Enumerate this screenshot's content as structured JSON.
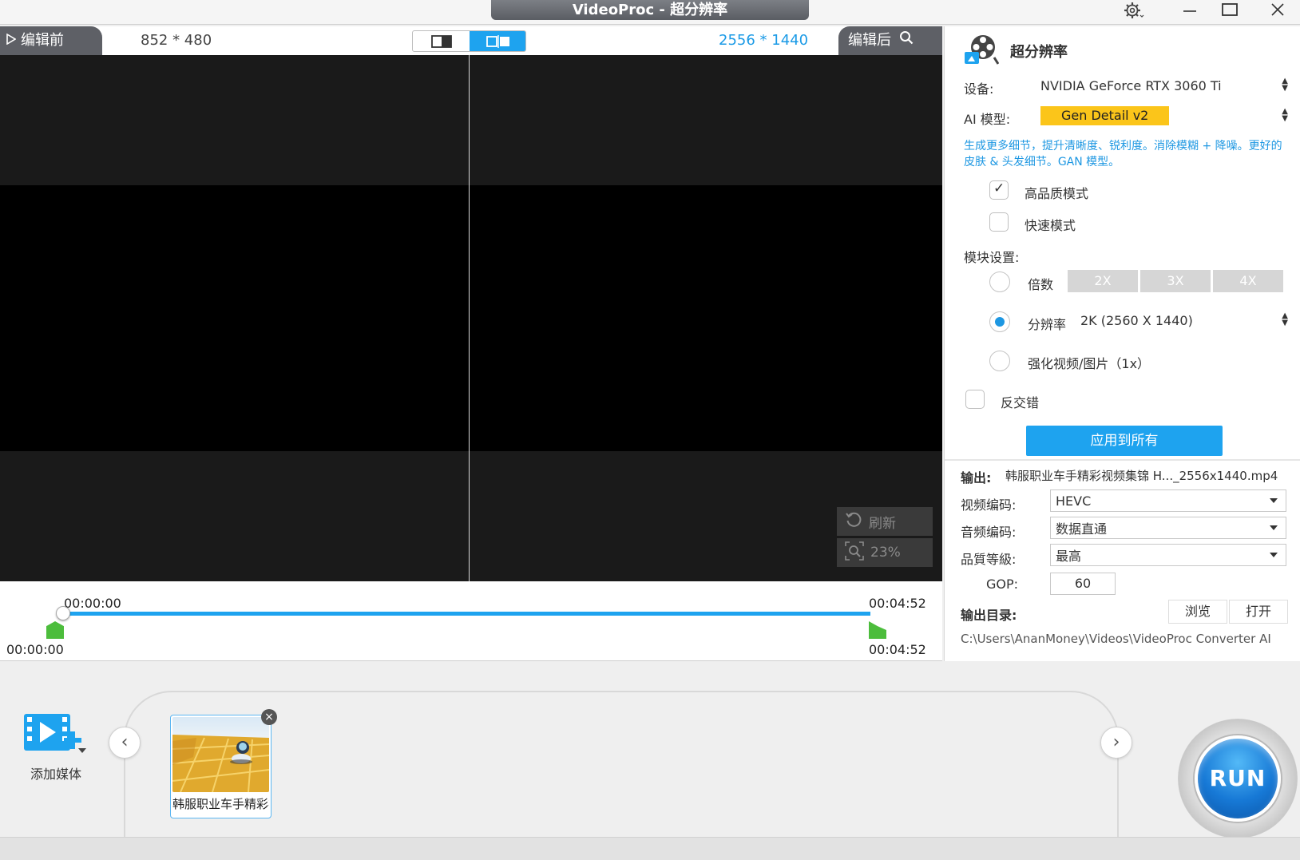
{
  "window": {
    "title": "VideoProc -  超分辨率",
    "settings_icon": "gear-icon",
    "minimize_icon": "minimize-icon",
    "maximize_icon": "maximize-icon",
    "close_icon": "close-icon"
  },
  "preview": {
    "before_tab": "编辑前",
    "after_tab": "编辑后",
    "input_resolution": "852 * 480",
    "output_resolution": "2556 * 1440",
    "refresh_label": "刷新",
    "zoom_label": "23%"
  },
  "timeline": {
    "current_start": "00:00:00",
    "current_end": "00:04:52",
    "range_start": "00:00:00",
    "range_end": "00:04:52",
    "progress_fraction": 1.0
  },
  "panel": {
    "title": "超分辨率",
    "device_label": "设备:",
    "device_value": "NVIDIA GeForce RTX 3060 Ti",
    "model_label": "AI 模型:",
    "model_value": "Gen Detail v2",
    "model_description": "生成更多细节，提升清晰度、锐利度。消除模糊 + 降噪。更好的皮肤 & 头发细节。GAN 模型。",
    "high_quality_label": "高品质模式",
    "high_quality_checked": true,
    "fast_mode_label": "快速模式",
    "fast_mode_checked": false,
    "module_label": "模块设置:",
    "scale_label": "倍数",
    "scale_options": [
      "2X",
      "3X",
      "4X"
    ],
    "resolution_label": "分辨率",
    "resolution_value": "2K (2560 X 1440)",
    "enhance_label": "强化视频/图片（1x）",
    "deinterlace_label": "反交错",
    "apply_all_label": "应用到所有",
    "output_label": "输出:",
    "output_filename": "韩服职业车手精彩视频集锦 H..._2556x1440.mp4",
    "video_codec_label": "视频编码:",
    "video_codec_value": "HEVC",
    "audio_codec_label": "音频编码:",
    "audio_codec_value": "数据直通",
    "quality_label": "品質等級:",
    "quality_value": "最高",
    "gop_label": "GOP:",
    "gop_value": "60",
    "output_dir_label": "输出目录:",
    "browse_label": "浏览",
    "open_label": "打开",
    "output_path": "C:\\Users\\AnanMoney\\Videos\\VideoProc Converter AI"
  },
  "bottom": {
    "add_media_label": "添加媒体",
    "clip_name": "韩服职业车手精彩视频集锦",
    "run_label": "RUN"
  },
  "colors": {
    "accent": "#1ea3ef",
    "model_tag": "#fbc51a",
    "marker": "#4cbd3c"
  }
}
